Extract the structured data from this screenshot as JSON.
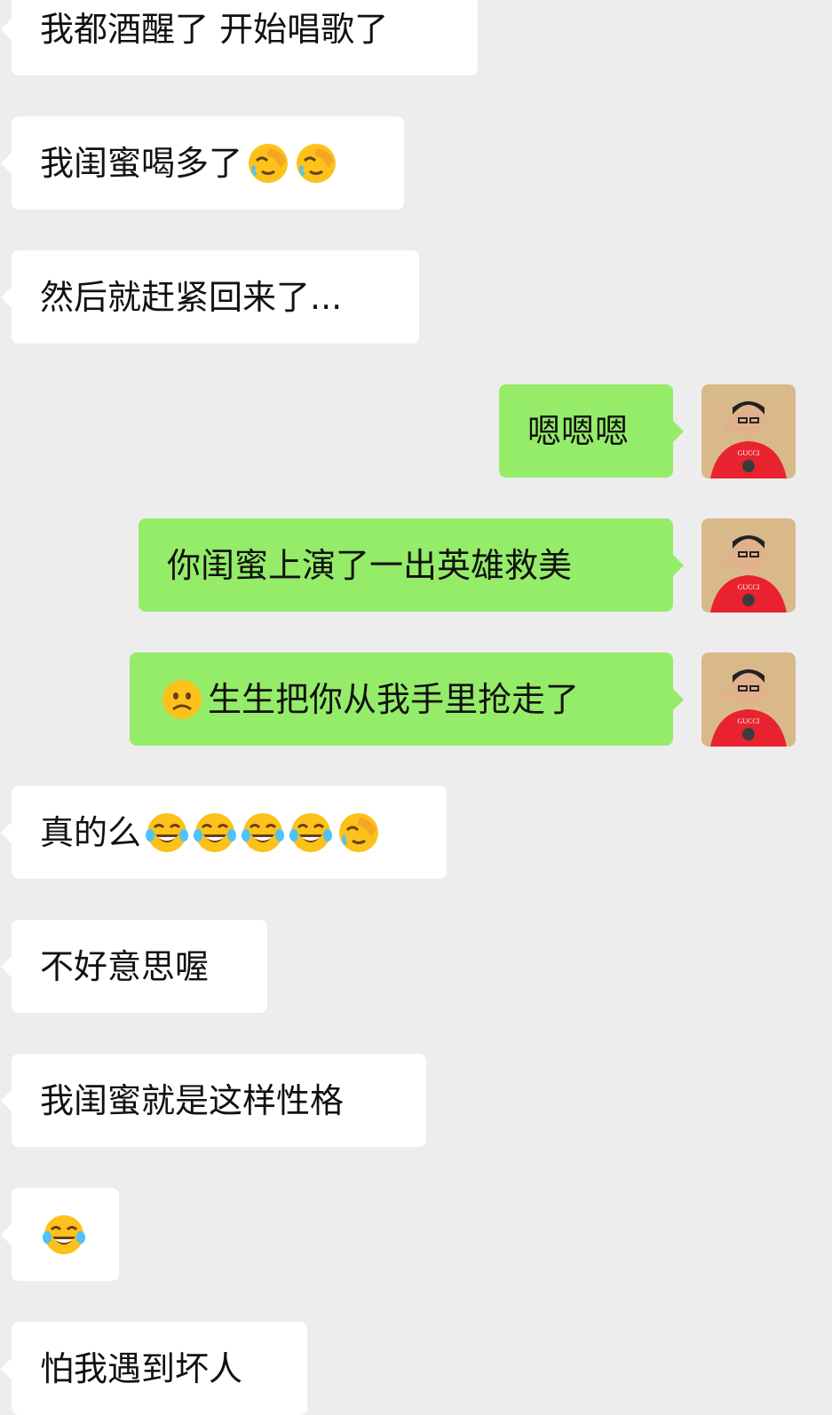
{
  "messages": [
    {
      "side": "in",
      "text": "我都酒醒了 开始唱歌了",
      "emojis": []
    },
    {
      "side": "in",
      "text": "我闺蜜喝多了",
      "emojis": [
        "facepalm-face",
        "facepalm-face"
      ]
    },
    {
      "side": "in",
      "text": "然后就赶紧回来了...",
      "emojis": []
    },
    {
      "side": "out",
      "text": "嗯嗯嗯",
      "emojis": []
    },
    {
      "side": "out",
      "text": "你闺蜜上演了一出英雄救美",
      "emojis": []
    },
    {
      "side": "out",
      "text": "生生把你从我手里抢走了",
      "leading_emoji": "frowning-face",
      "emojis": []
    },
    {
      "side": "in",
      "text": "真的么",
      "emojis": [
        "tears-of-joy-face",
        "tears-of-joy-face",
        "tears-of-joy-face",
        "tears-of-joy-face",
        "facepalm-face"
      ]
    },
    {
      "side": "in",
      "text": "不好意思喔",
      "emojis": []
    },
    {
      "side": "in",
      "text": "我闺蜜就是这样性格",
      "emojis": []
    },
    {
      "side": "in",
      "text": "",
      "emojis": [
        "tears-of-joy-face"
      ]
    },
    {
      "side": "in",
      "text": "怕我遇到坏人",
      "emojis": []
    }
  ],
  "avatar": {
    "icon": "user-avatar",
    "shirt_text": "GUCCI"
  },
  "colors": {
    "background": "#ededed",
    "incoming": "#ffffff",
    "outgoing": "#95ec69"
  }
}
